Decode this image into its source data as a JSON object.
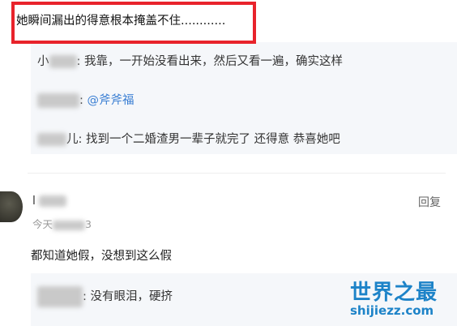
{
  "highlight": {
    "text": "她瞬间漏出的得意根本掩盖不住............"
  },
  "replies": [
    {
      "name_visible": "小",
      "text": ": 我靠，一开始没看出来，然后又看一遍，确实这样"
    },
    {
      "name_visible": "",
      "text": ": ",
      "mention": "@斧斧福"
    },
    {
      "name_visible": "儿",
      "text": ": 找到一个二婚渣男一辈子就完了 还得意 恭喜她吧"
    }
  ],
  "comment": {
    "username": "l",
    "time": "今天",
    "time_suffix": "3",
    "reply_label": "回复",
    "text": "都知道她假，没想到这么假"
  },
  "reply2": {
    "name_visible": "",
    "text": ": 没有眼泪，硬挤"
  },
  "watermark": {
    "title": "世界之最",
    "url": "shijiezz.com"
  },
  "colors": {
    "highlight_border": "#e8232b",
    "mention": "#3b7fd3",
    "panel_bg": "#f5f7fa",
    "watermark": "#1d83c8"
  }
}
